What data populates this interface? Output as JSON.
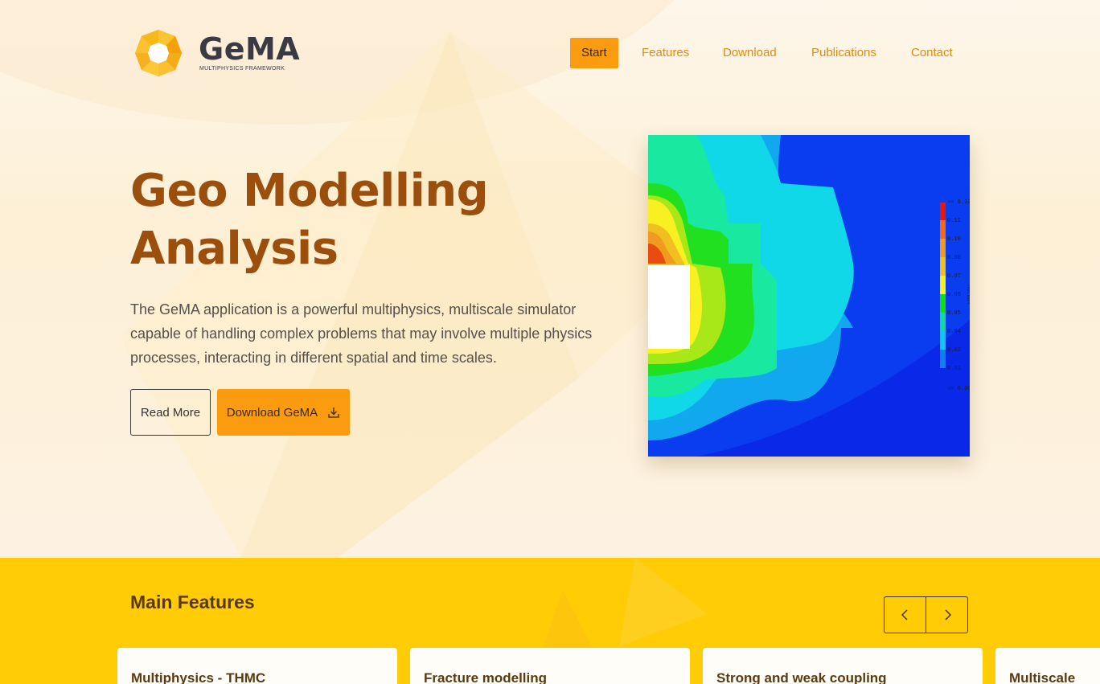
{
  "brand": {
    "name": "GeMA",
    "tagline": "MULTIPHYSICS FRAMEWORK"
  },
  "nav": {
    "items": [
      {
        "label": "Start",
        "active": true
      },
      {
        "label": "Features",
        "active": false
      },
      {
        "label": "Download",
        "active": false
      },
      {
        "label": "Publications",
        "active": false
      },
      {
        "label": "Contact",
        "active": false
      }
    ]
  },
  "hero": {
    "title_line1": "Geo Modelling",
    "title_line2": "Analysis",
    "description": "The GeMA application is a powerful multiphysics, multiscale simulator capable of handling complex problems that may involve multiple physics processes, interacting in different spatial and time scales.",
    "read_more_label": "Read More",
    "download_label": "Download GeMA"
  },
  "plot": {
    "legend_labels": [
      ">= 0.12",
      "0.11",
      "0.10",
      "0.08",
      "0.07",
      "0.06",
      "0.05",
      "0.04",
      "0.02",
      "0.01",
      "<= 0.00"
    ],
    "legend_colors": [
      "#e8180c",
      "#f06a18",
      "#f09a20",
      "#f0c020",
      "#f8f020",
      "#a8e818",
      "#10e010",
      "#10d8a0",
      "#10c8e8",
      "#1080f0",
      "#1020e0"
    ],
    "axis_title": "normal"
  },
  "features": {
    "title": "Main Features",
    "cards": [
      {
        "title": "Multiphysics - THMC"
      },
      {
        "title": "Fracture modelling"
      },
      {
        "title": "Strong and weak coupling"
      },
      {
        "title": "Multiscale"
      }
    ]
  },
  "colors": {
    "accent": "#fb9b10",
    "title": "#9c4f0c",
    "section_bg": "#ffcc05"
  }
}
